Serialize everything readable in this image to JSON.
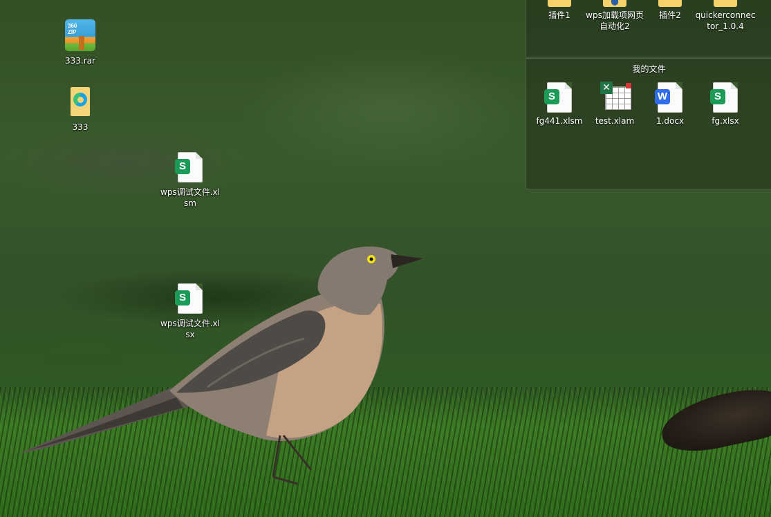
{
  "desktop_icons": [
    {
      "label": "333.rar",
      "type": "archive",
      "icon": "zip-archive-icon",
      "badge": "360\nZIP"
    },
    {
      "label": "333",
      "type": "folder",
      "icon": "folder-edge-icon"
    },
    {
      "label": "wps调试文件.xlsm",
      "type": "spreadsheet",
      "icon": "wps-spreadsheet-icon",
      "badge": "S"
    },
    {
      "label": "wps调试文件.xlsx",
      "type": "spreadsheet",
      "icon": "wps-spreadsheet-icon",
      "badge": "S"
    }
  ],
  "fence_top": {
    "items": [
      {
        "label": "插件1",
        "icon": "folder-icon"
      },
      {
        "label": "wps加载项网页自动化2",
        "icon": "folder-icon"
      },
      {
        "label": "插件2",
        "icon": "folder-icon"
      },
      {
        "label": "quickerconnector_1.0.4",
        "icon": "folder-icon"
      }
    ]
  },
  "fence_main": {
    "title": "我的文件",
    "items": [
      {
        "label": "fg441.xlsm",
        "icon": "wps-spreadsheet-icon",
        "badge": "S"
      },
      {
        "label": "test.xlam",
        "icon": "excel-addin-icon"
      },
      {
        "label": "1.docx",
        "icon": "word-document-icon",
        "badge": "W"
      },
      {
        "label": "fg.xlsx",
        "icon": "wps-spreadsheet-icon",
        "badge": "S"
      }
    ]
  },
  "colors": {
    "wps_green": "#1b9a58",
    "word_blue": "#2f6ee8",
    "folder_yellow": "#f6d26a",
    "excel_green": "#217346"
  }
}
